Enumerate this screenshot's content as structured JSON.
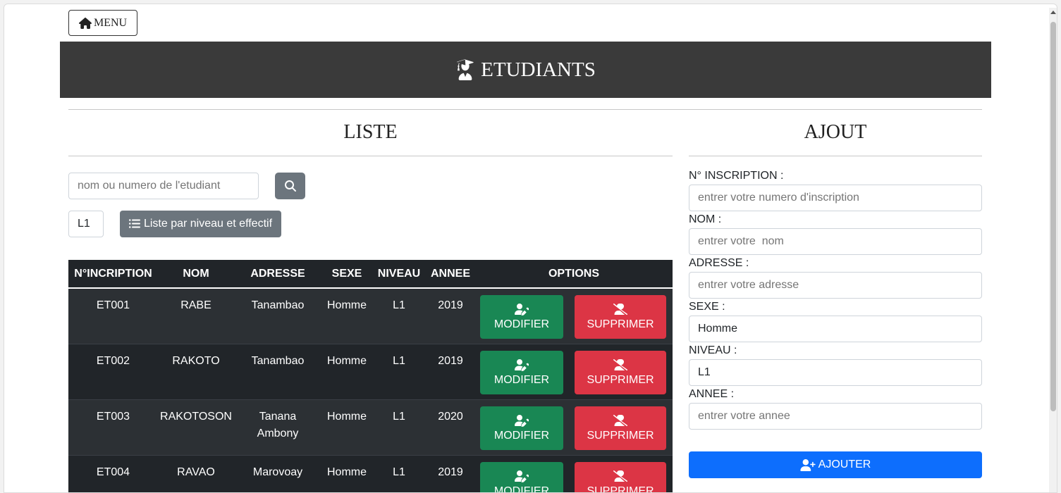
{
  "menu": {
    "label": "MENU"
  },
  "banner": {
    "title": "ETUDIANTS"
  },
  "liste": {
    "title": "LISTE",
    "search_placeholder": "nom ou numero de l'etudiant",
    "level_value": "L1",
    "list_button": "Liste par niveau et effectif"
  },
  "table": {
    "headers": [
      "N°INCRIPTION",
      "NOM",
      "ADRESSE",
      "SEXE",
      "NIVEAU",
      "ANNEE",
      "OPTIONS"
    ],
    "rows": [
      {
        "num": "ET001",
        "nom": "RABE",
        "adresse": "Tanambao",
        "sexe": "Homme",
        "niveau": "L1",
        "annee": "2019"
      },
      {
        "num": "ET002",
        "nom": "RAKOTO",
        "adresse": "Tanambao",
        "sexe": "Homme",
        "niveau": "L1",
        "annee": "2019"
      },
      {
        "num": "ET003",
        "nom": "RAKOTOSON",
        "adresse": "Tanana Ambony",
        "sexe": "Homme",
        "niveau": "L1",
        "annee": "2020"
      },
      {
        "num": "ET004",
        "nom": "RAVAO",
        "adresse": "Marovoay",
        "sexe": "Homme",
        "niveau": "L1",
        "annee": "2019"
      }
    ],
    "modify_label": "MODIFIER",
    "delete_label": "SUPPRIMER"
  },
  "ajout": {
    "title": "AJOUT",
    "fields": [
      {
        "label": "N° INSCRIPTION :",
        "placeholder": "entrer votre numero d'inscription",
        "value": ""
      },
      {
        "label": "NOM :",
        "placeholder": "entrer votre  nom",
        "value": ""
      },
      {
        "label": "ADRESSE :",
        "placeholder": "entrer votre adresse",
        "value": ""
      },
      {
        "label": "SEXE :",
        "placeholder": "",
        "value": "Homme"
      },
      {
        "label": "NIVEAU :",
        "placeholder": "",
        "value": "L1"
      },
      {
        "label": "ANNEE :",
        "placeholder": "entrer votre annee",
        "value": ""
      }
    ],
    "submit_label": "AJOUTER"
  },
  "colors": {
    "banner_bg": "#3a3a3a",
    "table_bg": "#212529",
    "modify": "#198754",
    "delete": "#dc3545",
    "primary": "#0d6efd",
    "secondary": "#6c757d"
  }
}
